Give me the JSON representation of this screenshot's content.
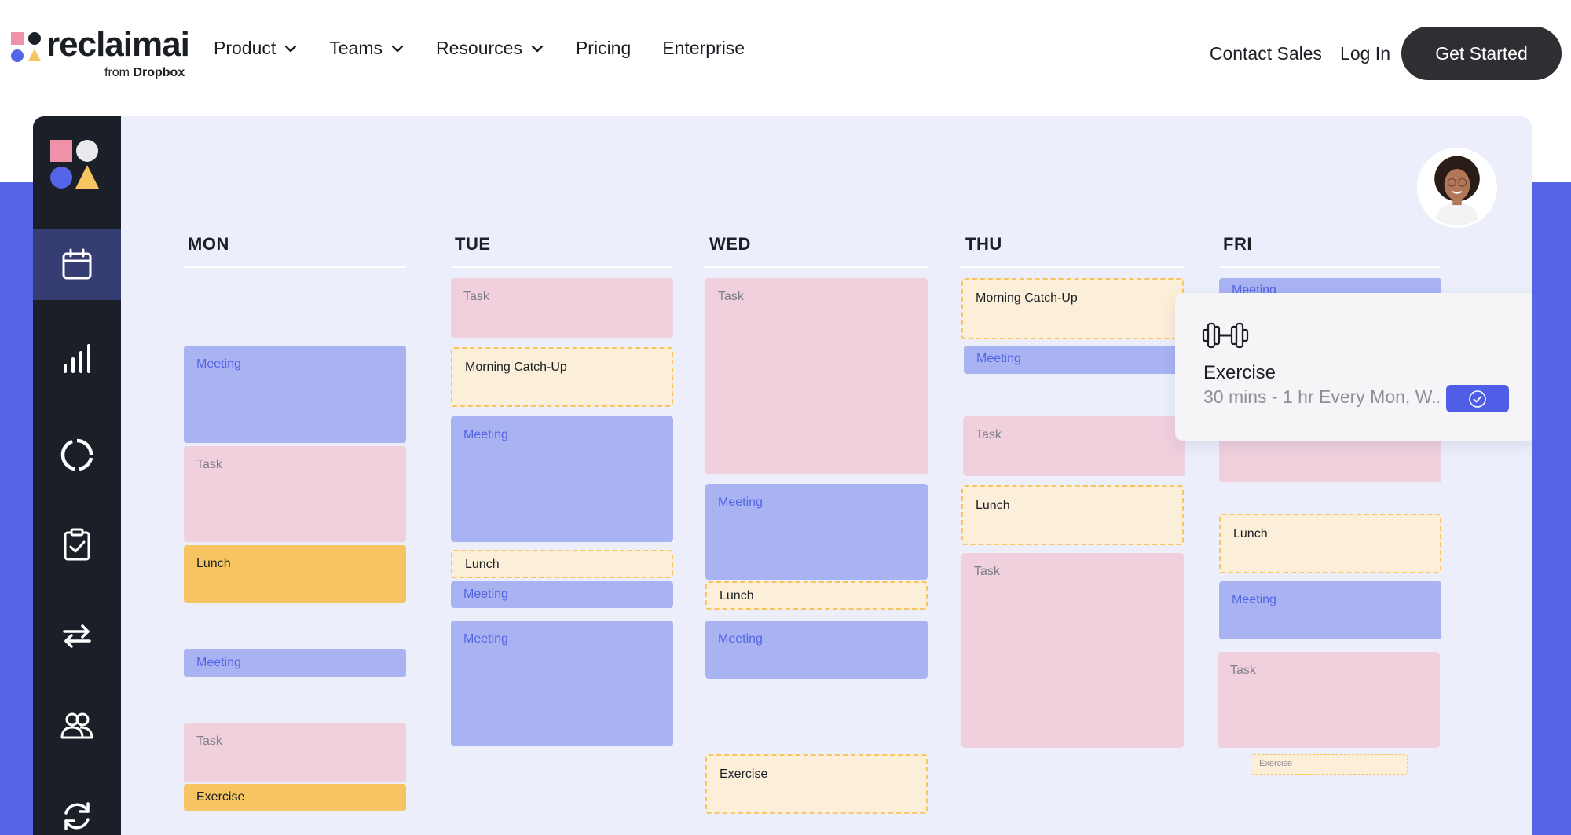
{
  "brand": {
    "name": "reclaimai",
    "sub_prefix": "from",
    "sub_brand": "Dropbox",
    "colors": {
      "pink": "#ef91a8",
      "dark": "#1b1f27",
      "blue": "#5565e8",
      "yellow": "#f6c561"
    }
  },
  "nav": {
    "items": [
      {
        "label": "Product",
        "has_dropdown": true
      },
      {
        "label": "Teams",
        "has_dropdown": true
      },
      {
        "label": "Resources",
        "has_dropdown": true
      },
      {
        "label": "Pricing",
        "has_dropdown": false
      },
      {
        "label": "Enterprise",
        "has_dropdown": false
      }
    ],
    "contact_sales": "Contact Sales",
    "log_in": "Log In",
    "get_started": "Get Started"
  },
  "sidebar": {
    "items": [
      {
        "icon": "calendar-icon",
        "active": true
      },
      {
        "icon": "bar-chart-icon",
        "active": false
      },
      {
        "icon": "ring-progress-icon",
        "active": false
      },
      {
        "icon": "clipboard-check-icon",
        "active": false
      },
      {
        "icon": "sync-arrows-icon",
        "active": false
      },
      {
        "icon": "people-icon",
        "active": false
      },
      {
        "icon": "refresh-icon",
        "active": false
      }
    ]
  },
  "calendar": {
    "days": [
      {
        "label": "MON",
        "events": [
          {
            "type": "meeting",
            "label": "Meeting"
          },
          {
            "type": "task",
            "label": "Task"
          },
          {
            "type": "habit",
            "label": "Lunch"
          },
          {
            "type": "meeting",
            "label": "Meeting"
          },
          {
            "type": "task",
            "label": "Task"
          },
          {
            "type": "habit",
            "label": "Exercise"
          }
        ]
      },
      {
        "label": "TUE",
        "events": [
          {
            "type": "task",
            "label": "Task"
          },
          {
            "type": "dashed",
            "label": "Morning Catch-Up"
          },
          {
            "type": "meeting",
            "label": "Meeting"
          },
          {
            "type": "dashed",
            "label": "Lunch"
          },
          {
            "type": "meeting",
            "label": "Meeting"
          },
          {
            "type": "meeting",
            "label": "Meeting"
          }
        ]
      },
      {
        "label": "WED",
        "events": [
          {
            "type": "task",
            "label": "Task"
          },
          {
            "type": "meeting",
            "label": "Meeting"
          },
          {
            "type": "dashed",
            "label": "Lunch"
          },
          {
            "type": "meeting",
            "label": "Meeting"
          },
          {
            "type": "dashed",
            "label": "Exercise"
          }
        ]
      },
      {
        "label": "THU",
        "events": [
          {
            "type": "dashed",
            "label": "Morning Catch-Up"
          },
          {
            "type": "meeting",
            "label": "Meeting"
          },
          {
            "type": "task",
            "label": "Task"
          },
          {
            "type": "dashed",
            "label": "Lunch"
          },
          {
            "type": "task",
            "label": "Task"
          }
        ]
      },
      {
        "label": "FRI",
        "events": [
          {
            "type": "meeting",
            "label": "Meeting"
          },
          {
            "type": "task",
            "label": ""
          },
          {
            "type": "dashed",
            "label": "Lunch"
          },
          {
            "type": "meeting",
            "label": "Meeting"
          },
          {
            "type": "task",
            "label": "Task"
          },
          {
            "type": "dashed",
            "label": "Exercise"
          }
        ]
      }
    ]
  },
  "popup": {
    "icon": "dumbbell-icon",
    "title": "Exercise",
    "subtitle": "30 mins - 1 hr Every Mon, W...",
    "action_icon": "check-circle-icon"
  }
}
